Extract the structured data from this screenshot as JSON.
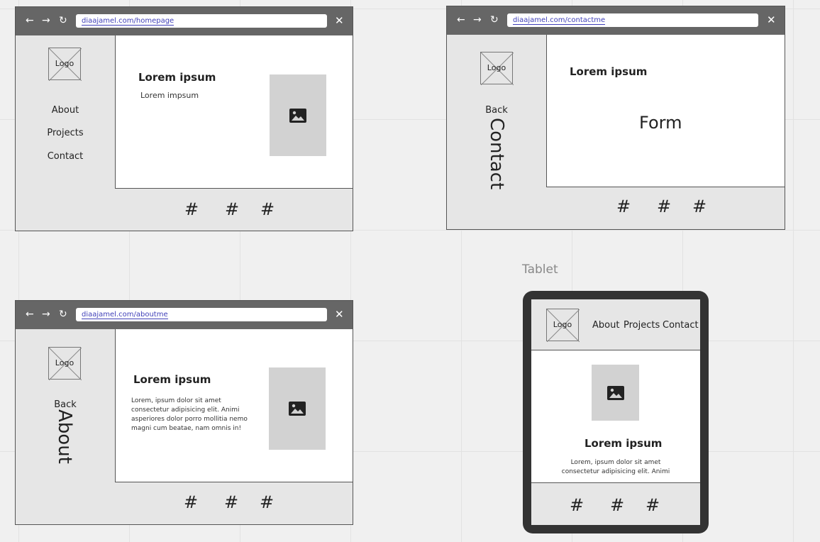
{
  "homepage": {
    "url": "diaajamel.com/homepage",
    "logo": "Logo",
    "nav": [
      "About",
      "Projects",
      "Contact"
    ],
    "heading": "Lorem ipsum",
    "body": "Lorem impsum",
    "footer": [
      "#",
      "#",
      "#"
    ]
  },
  "contact": {
    "url": "diaajamel.com/contactme",
    "logo": "Logo",
    "back": "Back",
    "section": "Contact",
    "heading": "Lorem ipsum",
    "form": "Form",
    "footer": [
      "#",
      "#",
      "#"
    ]
  },
  "about": {
    "url": "diaajamel.com/aboutme",
    "logo": "Logo",
    "back": "Back",
    "section": "About",
    "heading": "Lorem ipsum",
    "body_lines": [
      "Lorem, ipsum dolor sit amet",
      "consectetur adipisicing elit. Animi",
      "asperiores dolor porro mollitia nemo",
      "magni cum beatae, nam omnis in!"
    ],
    "footer": [
      "#",
      "#",
      "#"
    ]
  },
  "tablet": {
    "label": "Tablet",
    "logo": "Logo",
    "nav": [
      "About",
      "Projects",
      "Contact"
    ],
    "heading": "Lorem ipsum",
    "body_lines": [
      "Lorem, ipsum dolor sit amet",
      "consectetur adipisicing elit. Animi"
    ],
    "footer": [
      "#",
      "#",
      "#"
    ]
  },
  "chrome": {
    "back_icon": "arrow-left",
    "forward_icon": "arrow-right",
    "reload_icon": "reload",
    "close_icon": "close"
  },
  "colors": {
    "chrome": "#666666",
    "sidebar": "#e6e6e6",
    "placeholder": "#d2d2d2",
    "url": "#3f3fb8",
    "tablet_bezel": "#333333"
  }
}
